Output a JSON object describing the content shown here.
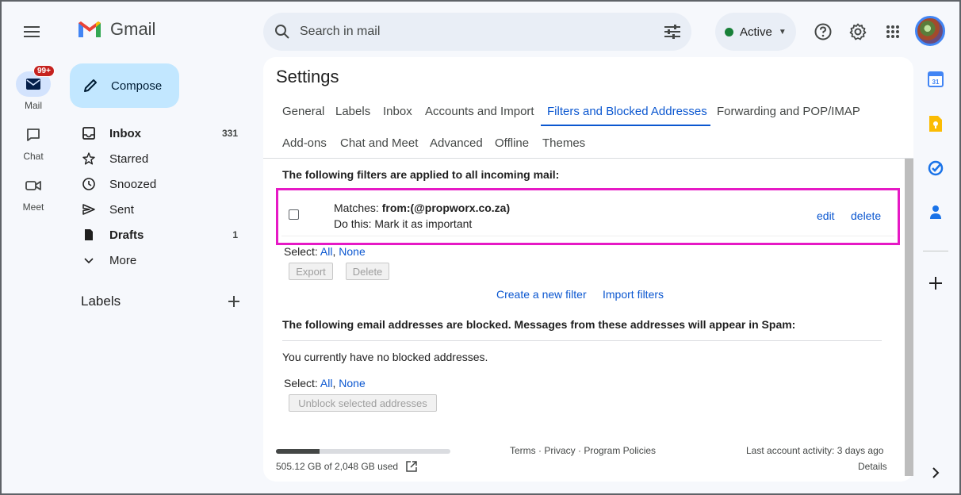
{
  "header": {
    "app_name": "Gmail",
    "search_placeholder": "Search in mail",
    "status_label": "Active"
  },
  "rail": {
    "mail_label": "Mail",
    "mail_badge": "99+",
    "chat_label": "Chat",
    "meet_label": "Meet"
  },
  "compose_label": "Compose",
  "nav": {
    "inbox": {
      "label": "Inbox",
      "count": "331"
    },
    "starred": {
      "label": "Starred"
    },
    "snoozed": {
      "label": "Snoozed"
    },
    "sent": {
      "label": "Sent"
    },
    "drafts": {
      "label": "Drafts",
      "count": "1"
    },
    "more": {
      "label": "More"
    }
  },
  "labels_heading": "Labels",
  "settings": {
    "title": "Settings",
    "tabs": [
      "General",
      "Labels",
      "Inbox",
      "Accounts and Import",
      "Filters and Blocked Addresses",
      "Forwarding and POP/IMAP",
      "Add-ons",
      "Chat and Meet",
      "Advanced",
      "Offline",
      "Themes"
    ],
    "active_tab": "Filters and Blocked Addresses"
  },
  "filters": {
    "heading": "The following filters are applied to all incoming mail:",
    "items": [
      {
        "matches_label": "Matches: ",
        "matches_value": "from:(@propworx.co.za)",
        "action_text": "Do this: Mark it as important",
        "edit_label": "edit",
        "delete_label": "delete"
      }
    ],
    "select_label": "Select: ",
    "select_all": "All",
    "select_sep": ", ",
    "select_none": "None",
    "export_label": "Export",
    "delete_label": "Delete",
    "create_link": "Create a new filter",
    "import_link": "Import filters"
  },
  "blocked": {
    "heading": "The following email addresses are blocked. Messages from these addresses will appear in Spam:",
    "empty_text": "You currently have no blocked addresses.",
    "select_label": "Select: ",
    "select_all": "All",
    "select_sep": ", ",
    "select_none": "None",
    "unblock_label": "Unblock selected addresses"
  },
  "footer": {
    "storage_text": "505.12 GB of 2,048 GB used",
    "storage_fraction": 0.25,
    "links": "Terms · Privacy · Program Policies",
    "last_activity": "Last account activity: 3 days ago",
    "details": "Details"
  },
  "colors": {
    "accent": "#0b57d0",
    "highlight_border": "#e619c5",
    "compose_bg": "#c2e7ff",
    "status_green": "#188038"
  }
}
